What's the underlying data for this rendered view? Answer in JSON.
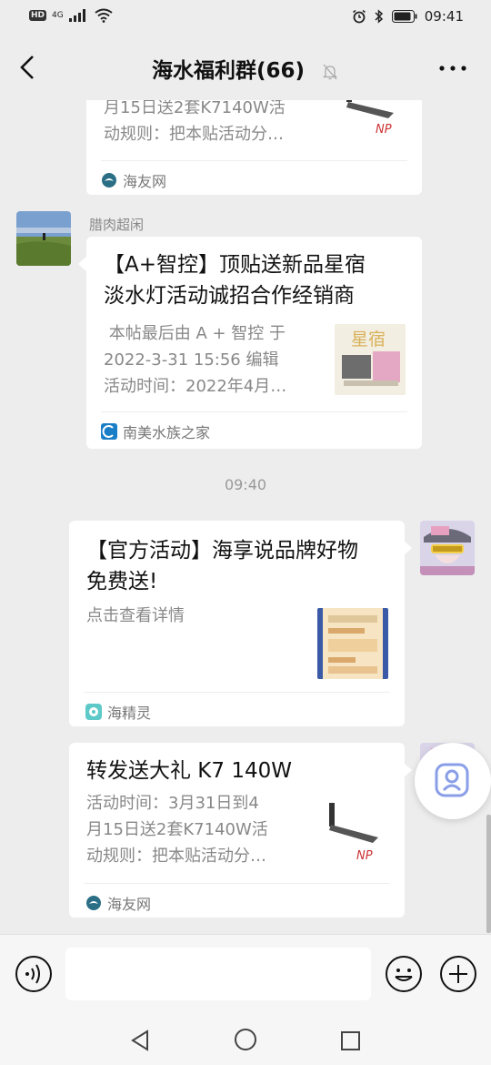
{
  "status_bar": {
    "hd_label": "HD",
    "network_label": "4G",
    "time": "09:41"
  },
  "header": {
    "title": "海水福利群(66)"
  },
  "messages": [
    {
      "title_partial": "",
      "desc_lines": [
        "月15日送2套K7140W活",
        "动规则：把本贴活动分…"
      ],
      "source": "海友网"
    },
    {
      "sender": "腊肉超闲",
      "title_lines": [
        "【A+智控】顶贴送新品星宿",
        "淡水灯活动诚招合作经销商"
      ],
      "desc_lines": [
        " 本帖最后由 A + 智控 于",
        "2022-3-31 15:56 编辑",
        "活动时间：2022年4月…"
      ],
      "thumb_text": "星宿",
      "source": "南美水族之家"
    },
    {
      "timestamp": "09:40"
    },
    {
      "title_lines": [
        "【官方活动】海享说品牌好物",
        "免费送!"
      ],
      "desc_lines": [
        "点击查看详情"
      ],
      "source": "海精灵"
    },
    {
      "title_lines": [
        "转发送大礼 K7 140W"
      ],
      "desc_lines": [
        "活动时间：3月31日到4",
        "月15日送2套K7140W活",
        "动规则：把本贴活动分…"
      ],
      "source": "海友网"
    }
  ],
  "icons": {
    "back": "chevron-left-icon",
    "mute": "bell-off-icon",
    "more": "more-dots-icon",
    "voice": "voice-icon",
    "emoji": "emoji-icon",
    "plus": "plus-icon"
  }
}
